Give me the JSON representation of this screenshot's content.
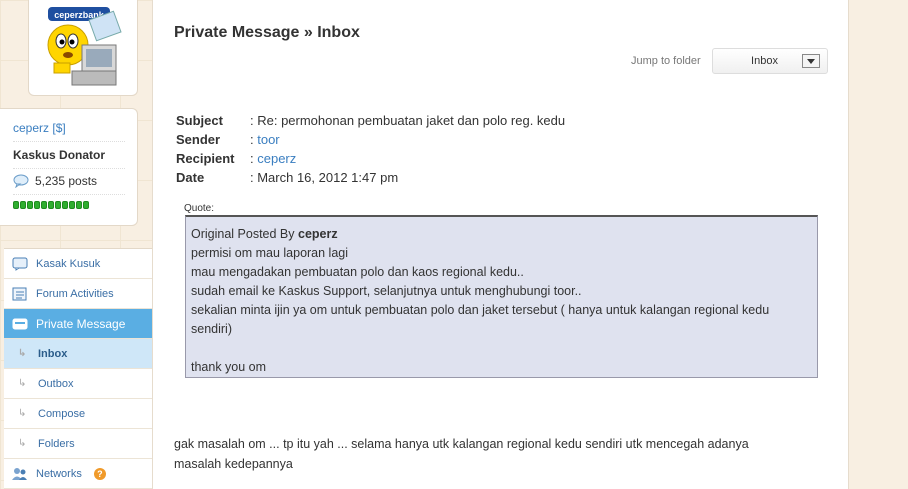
{
  "app": {
    "logo_text": "ceperzbank"
  },
  "profile": {
    "username": "ceperz",
    "username_tag": "[$]",
    "title": "Kaskus Donator",
    "posts": "5,235 posts",
    "reputation_count": 11
  },
  "nav": {
    "items": [
      {
        "label": "Kasak Kusuk",
        "icon": "chat-icon"
      },
      {
        "label": "Forum Activities",
        "icon": "list-icon"
      },
      {
        "label": "Private Message",
        "icon": "envelope-icon"
      }
    ],
    "sub_items": [
      {
        "label": "Inbox"
      },
      {
        "label": "Outbox"
      },
      {
        "label": "Compose"
      },
      {
        "label": "Folders"
      }
    ],
    "networks": {
      "label": "Networks",
      "badge": "?"
    }
  },
  "page": {
    "title": "Private Message » Inbox",
    "jump_label": "Jump to folder",
    "folder_selected": "Inbox"
  },
  "message": {
    "subject_key": "Subject",
    "subject": ": Re: permohonan pembuatan jaket dan polo reg. kedu",
    "sender_key": "Sender",
    "sender": "toor",
    "recipient_key": "Recipient",
    "recipient": "ceperz",
    "date_key": "Date",
    "date": ": March 16, 2012 1:47 pm",
    "colon": ": "
  },
  "quote": {
    "label": "Quote:",
    "prefix": "Original Posted By ",
    "author": "ceperz",
    "lines": [
      "permisi om mau laporan lagi",
      "mau mengadakan pembuatan polo dan kaos regional kedu..",
      "sudah email ke Kaskus Support, selanjutnya untuk menghubungi toor..",
      "sekalian minta ijin ya om untuk pembuatan polo dan jaket tersebut ( hanya untuk kalangan regional kedu sendiri)",
      "",
      "thank you om"
    ]
  },
  "reply": "gak masalah om ... tp itu yah ... selama hanya utk kalangan regional kedu sendiri utk mencegah adanya masalah kedepannya"
}
